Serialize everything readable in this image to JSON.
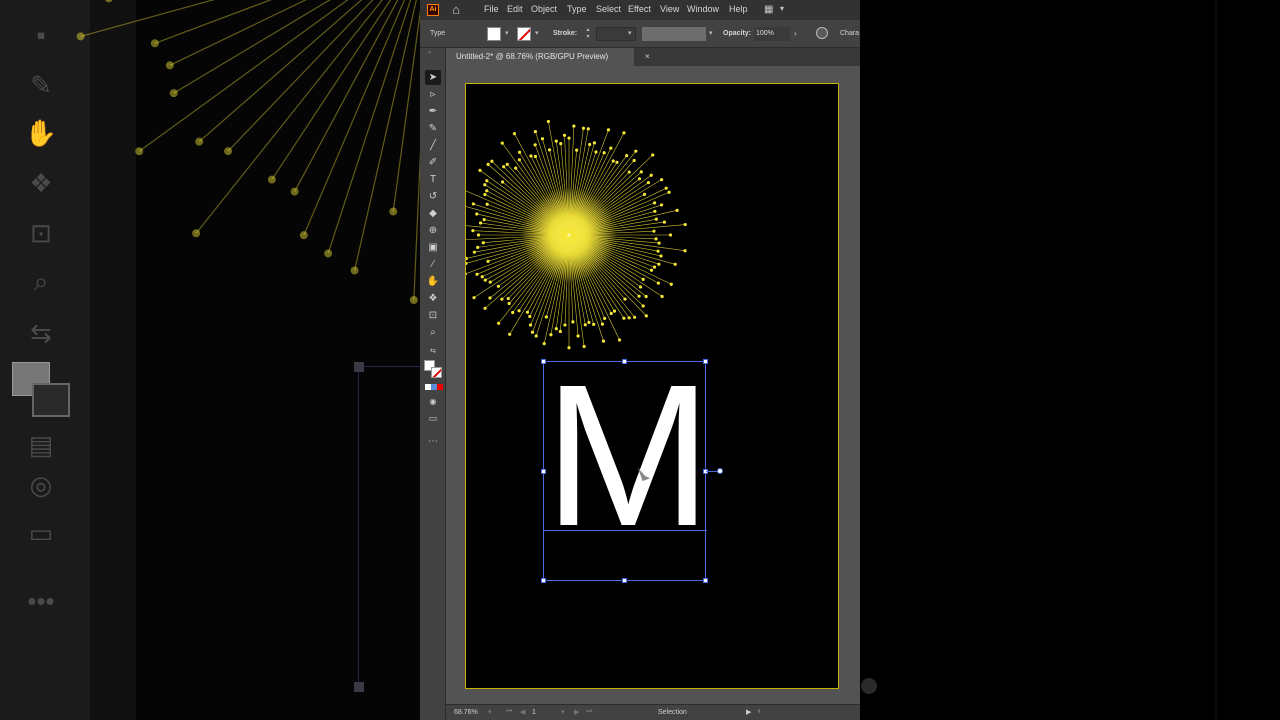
{
  "app": {
    "logo": "Ai",
    "menus": [
      "File",
      "Edit",
      "Object",
      "Type",
      "Select",
      "Effect",
      "View",
      "Window",
      "Help"
    ]
  },
  "control_bar": {
    "selection_type": "Type",
    "stroke_label": "Stroke:",
    "opacity_label": "Opacity:",
    "opacity_value": "100%",
    "panel_label": "Chara"
  },
  "document": {
    "tab_title": "Untitled-2* @ 68.76% (RGB/GPU Preview)",
    "close_glyph": "×"
  },
  "artwork": {
    "text": "M",
    "burst_color": "#f5e63a",
    "text_color": "#ffffff"
  },
  "status_bar": {
    "zoom": "68.76%",
    "artboard_number": "1",
    "active_tool": "Selection"
  },
  "colors": {
    "accent_selection": "#4a6adf",
    "artboard_border": "#c8b400",
    "panel_bg": "#424242",
    "menu_bg": "#323232"
  },
  "icons": {
    "tools": [
      "selection-tool-icon",
      "direct-selection-tool-icon",
      "pen-tool-icon",
      "curvature-tool-icon",
      "line-tool-icon",
      "paintbrush-tool-icon",
      "type-tool-icon",
      "rotate-tool-icon",
      "eraser-tool-icon",
      "shape-builder-icon",
      "gradient-tool-icon",
      "eyedropper-tool-icon",
      "puppet-warp-icon",
      "symbol-sprayer-icon",
      "artboard-tool-icon",
      "zoom-tool-icon"
    ]
  }
}
